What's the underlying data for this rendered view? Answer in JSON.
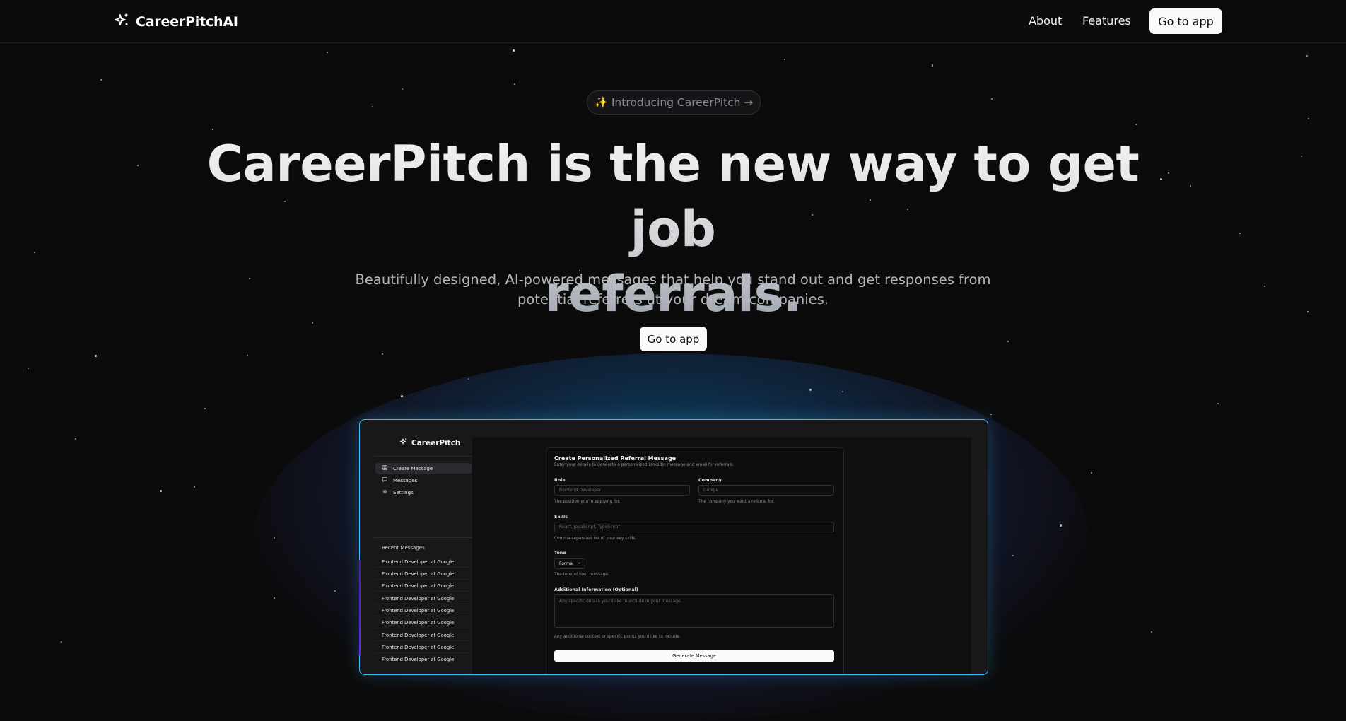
{
  "nav": {
    "brand": "CareerPitchAI",
    "links": [
      "About",
      "Features"
    ],
    "cta": "Go to app"
  },
  "hero": {
    "badge": "✨ Introducing CareerPitch →",
    "title_line1": "CareerPitch is the new way to get job",
    "title_line2": "referrals.",
    "subtitle": "Beautifully designed, AI-powered messages that help you stand out and get responses from potential referrers at your dream companies.",
    "cta": "Go to app"
  },
  "app": {
    "brand": "CareerPitch",
    "sidebar": [
      {
        "label": "Create Message",
        "icon": "grid-icon",
        "active": true
      },
      {
        "label": "Messages",
        "icon": "message-icon",
        "active": false
      },
      {
        "label": "Settings",
        "icon": "gear-icon",
        "active": false
      }
    ],
    "recent_title": "Recent Messages",
    "recent": [
      "Frontend Developer at Google",
      "Frontend Developer at Google",
      "Frontend Developer at Google",
      "Frontend Developer at Google",
      "Frontend Developer at Google",
      "Frontend Developer at Google",
      "Frontend Developer at Google",
      "Frontend Developer at Google",
      "Frontend Developer at Google"
    ],
    "form": {
      "title": "Create Personalized Referral Message",
      "description": "Enter your details to generate a personalized LinkedIn message and email for referrals.",
      "role_label": "Role",
      "role_placeholder": "Frontend Developer",
      "role_hint": "The position you're applying for.",
      "company_label": "Company",
      "company_placeholder": "Google",
      "company_hint": "The company you want a referral for.",
      "skills_label": "Skills",
      "skills_placeholder": "React, JavaScript, TypeScript",
      "skills_hint": "Comma-separated list of your key skills.",
      "tone_label": "Tone",
      "tone_value": "Formal",
      "tone_hint": "The tone of your message.",
      "additional_label": "Additional Information (Optional)",
      "additional_placeholder": "Any specific details you'd like to include in your message...",
      "additional_hint": "Any additional context or specific points you'd like to include.",
      "submit": "Generate Message"
    }
  }
}
